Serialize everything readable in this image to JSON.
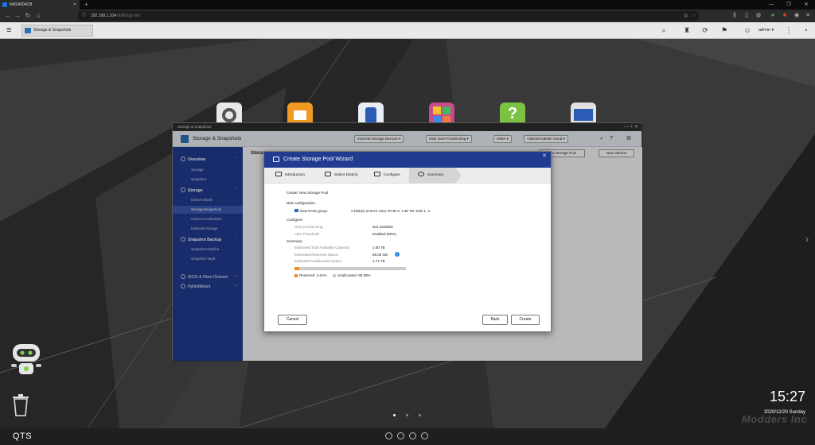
{
  "browser": {
    "tab_title": "NAS4004CB",
    "url_host": "192.168.1.104",
    "url_path": ":8080/cgi-bin/",
    "window_controls": [
      "—",
      "❐",
      "✕"
    ]
  },
  "qts_bar": {
    "task_label": "Storage & Snapshots",
    "user": "admin ▾"
  },
  "window": {
    "titlebar": "Storage & Snapshots",
    "app_name": "Storage & Snapshots",
    "header_buttons": [
      "External Storage Devices ▾",
      "SSD Over-Provisioning ▾",
      "Other ▾",
      "VJBOD/VJBOD Cloud ▾"
    ],
    "content_title": "Storage",
    "new_pool_label": "New Storage Pool",
    "new_volume_label": "New Volume"
  },
  "sidebar": {
    "sections": [
      {
        "label": "Overview",
        "items": [
          "Storage",
          "Snapshot"
        ]
      },
      {
        "label": "Storage",
        "items": [
          "Disks/VJBOD",
          "Storage/Snapshots",
          "Cache Acceleration",
          "External Storage"
        ]
      },
      {
        "label": "Snapshot Backup",
        "items": [
          "Snapshot Replica",
          "Snapshot Vault"
        ]
      }
    ],
    "extra": [
      "iSCSI & Fibre Channel",
      "HybridMount"
    ],
    "selected": "Storage/Snapshots"
  },
  "wizard": {
    "title": "Create Storage Pool Wizard",
    "steps": [
      "Introduction",
      "Select Disk(s)",
      "Configure",
      "Summary"
    ],
    "active_step": "Summary",
    "heading": "Create: New Storage Pool",
    "disk_config_label": "Disk configuration:",
    "raid_group_label": "New RAID group:",
    "raid_group_value": "2 Disk(s) at NAS Host, RAID 0, 1.80 TB: Disk 1, 2",
    "configure_label": "Configure:",
    "over_prov_label": "Over-provisioning:",
    "over_prov_value": "Not available",
    "alert_label": "Alert Threshold:",
    "alert_value": "Enabled (80%)",
    "summary_label": "Summary:",
    "total_label": "Estimated Total Available Capacity:",
    "total_value": "1.80 TB",
    "reserved_label": "Estimated Reserved Space:",
    "reserved_value": "85.03 GB",
    "unalloc_label": "Estimated Unallocated Space:",
    "unalloc_value": "1.72 TB",
    "reserved_pct": 4.61,
    "legend_reserved": "Reserved: 4.61%",
    "legend_unalloc": "Unallocated: 95.39%",
    "cancel_label": "Cancel",
    "back_label": "Back",
    "create_label": "Create"
  },
  "desktop": {
    "time": "15:27",
    "date": "2020/12/20 Sunday",
    "brand": "QTS",
    "watermark": "Modders Inc"
  },
  "colors": {
    "accent": "#203b8f",
    "reserved": "#f08a24",
    "unallocated": "#cccccc"
  }
}
